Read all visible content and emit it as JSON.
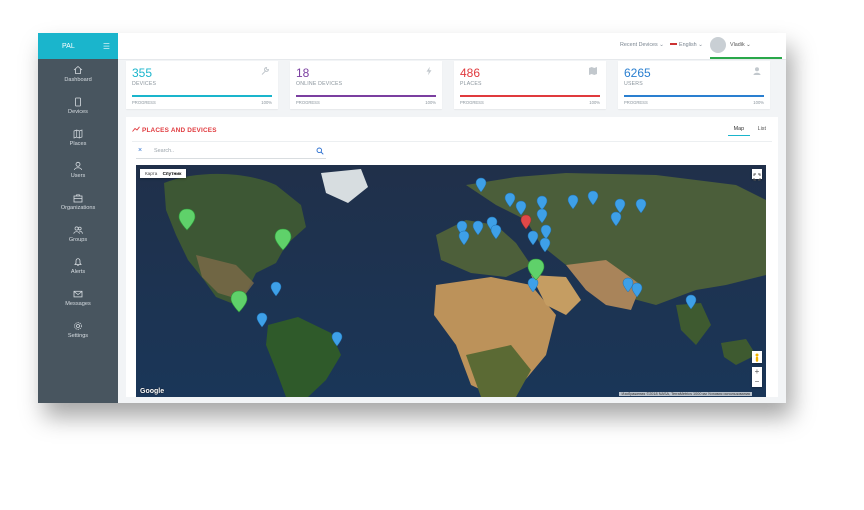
{
  "sidebar": {
    "brand": "PAL",
    "items": [
      {
        "label": "Dashboard",
        "icon": "home-icon"
      },
      {
        "label": "Devices",
        "icon": "tablet-icon"
      },
      {
        "label": "Places",
        "icon": "map-icon"
      },
      {
        "label": "Users",
        "icon": "user-icon"
      },
      {
        "label": "Organizations",
        "icon": "briefcase-icon"
      },
      {
        "label": "Groups",
        "icon": "users-icon"
      },
      {
        "label": "Alerts",
        "icon": "bell-icon"
      },
      {
        "label": "Messages",
        "icon": "envelope-icon"
      },
      {
        "label": "Settings",
        "icon": "gear-icon"
      }
    ]
  },
  "topbar": {
    "recent": "Recent Devices",
    "language": "English",
    "user": "Vladik"
  },
  "cards": [
    {
      "value": "355",
      "label": "DEVICES",
      "progress_label": "PROGRESS",
      "percent": "100%",
      "progress": 1.0,
      "color": "#1ab5cc",
      "icon": "wrench-icon"
    },
    {
      "value": "18",
      "label": "ONLINE DEVICES",
      "progress_label": "PROGRESS",
      "percent": "100%",
      "progress": 1.0,
      "color": "#7b3fa0",
      "icon": "bolt-icon"
    },
    {
      "value": "486",
      "label": "PLACES",
      "progress_label": "PROGRESS",
      "percent": "100%",
      "progress": 1.0,
      "color": "#e03a3e",
      "icon": "map-icon"
    },
    {
      "value": "6265",
      "label": "USERS",
      "progress_label": "PROGRESS",
      "percent": "100%",
      "progress": 1.0,
      "color": "#2a7fd0",
      "icon": "user-icon"
    }
  ],
  "panel": {
    "title": "PLACES AND DEVICES",
    "tabs": [
      "Map",
      "List"
    ],
    "active_tab": "Map",
    "search_placeholder": "Search.."
  },
  "map": {
    "type_buttons": [
      "Карта",
      "Спутник"
    ],
    "active_type": "Спутник",
    "logo": "Google",
    "attribution": "Изображения ©2018 NASA, TerraMetrics   1000 км   Условия использования",
    "colors": {
      "blue_pin": "#3ea0e8",
      "green_pin": "#5fd16a",
      "red_pin": "#e04848"
    }
  }
}
